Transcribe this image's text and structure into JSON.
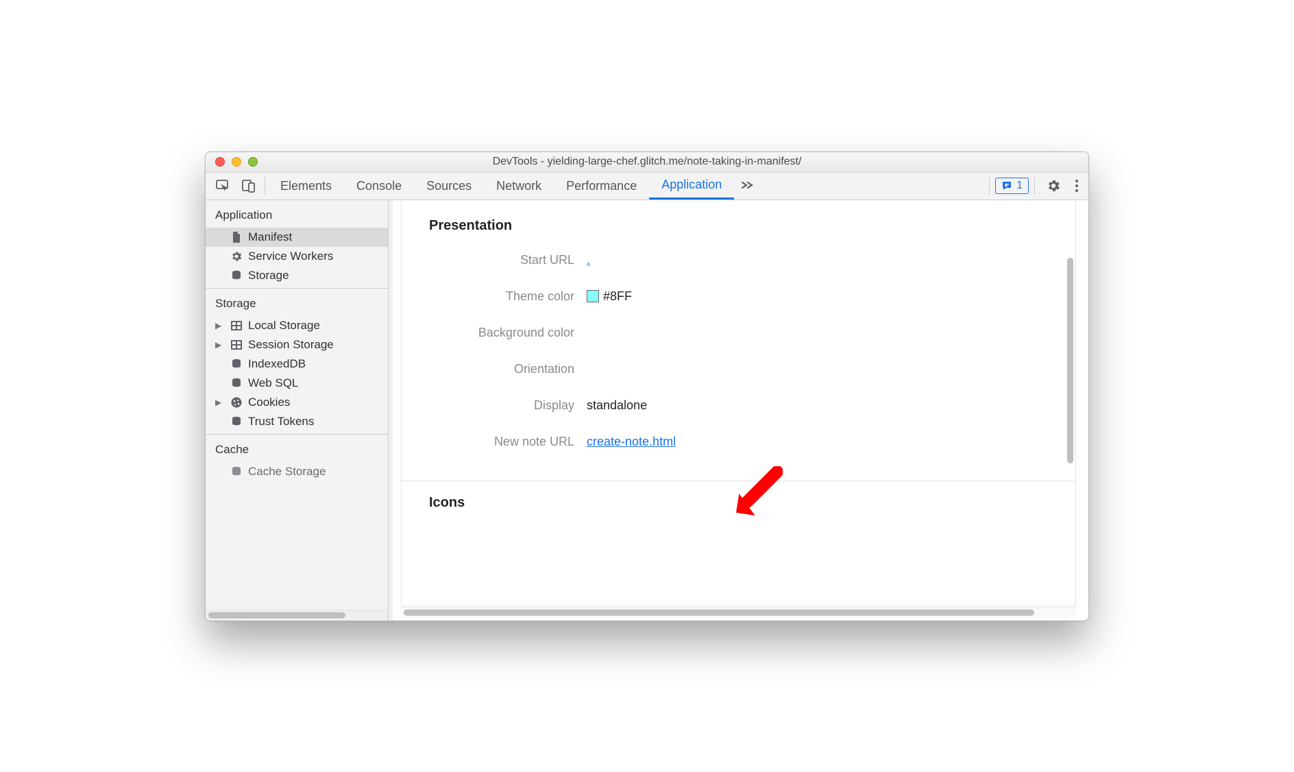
{
  "window": {
    "title": "DevTools - yielding-large-chef.glitch.me/note-taking-in-manifest/"
  },
  "toolbar": {
    "tabs": [
      "Elements",
      "Console",
      "Sources",
      "Network",
      "Performance",
      "Application"
    ],
    "active_index": 5,
    "errors_badge": "1"
  },
  "sidebar": {
    "sections": {
      "application": {
        "header": "Application",
        "items": [
          {
            "label": "Manifest",
            "icon": "file",
            "selected": true
          },
          {
            "label": "Service Workers",
            "icon": "gear"
          },
          {
            "label": "Storage",
            "icon": "db"
          }
        ]
      },
      "storage": {
        "header": "Storage",
        "items": [
          {
            "label": "Local Storage",
            "icon": "grid",
            "expandable": true
          },
          {
            "label": "Session Storage",
            "icon": "grid",
            "expandable": true
          },
          {
            "label": "IndexedDB",
            "icon": "db"
          },
          {
            "label": "Web SQL",
            "icon": "db"
          },
          {
            "label": "Cookies",
            "icon": "cookie",
            "expandable": true
          },
          {
            "label": "Trust Tokens",
            "icon": "db"
          }
        ]
      },
      "cache": {
        "header": "Cache",
        "items": [
          {
            "label": "Cache Storage",
            "icon": "db"
          }
        ]
      }
    }
  },
  "panel": {
    "presentation": {
      "heading": "Presentation",
      "start_url_label": "Start URL",
      "start_url_value": ".",
      "theme_color_label": "Theme color",
      "theme_color_value": "#8FF",
      "background_color_label": "Background color",
      "orientation_label": "Orientation",
      "display_label": "Display",
      "display_value": "standalone",
      "new_note_url_label": "New note URL",
      "new_note_url_value": "create-note.html"
    },
    "icons_heading": "Icons"
  }
}
